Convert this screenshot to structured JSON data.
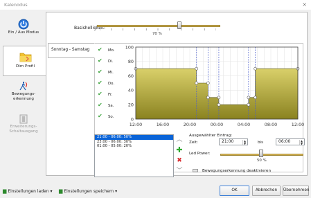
{
  "window": {
    "title": "Kalenodus",
    "close": "×"
  },
  "sidebar": {
    "items": [
      {
        "label": "Ein / Aus Modus"
      },
      {
        "label": "Dim Profil"
      },
      {
        "label": "Bewegungs-erkennung"
      },
      {
        "label": "Erweiterungs-Schaltausgang"
      }
    ]
  },
  "brightness": {
    "label": "Basishelligkeit:",
    "percent": "70 %",
    "value": 0.7
  },
  "day_tab": {
    "label": "Sonntag - Samstag"
  },
  "days": [
    "Mo.",
    "Di.",
    "Mi.",
    "Do.",
    "Fr.",
    "Sa.",
    "So."
  ],
  "chart_data": {
    "type": "area",
    "x_ticks": [
      "12:00",
      "16:00",
      "20:00",
      "00:00",
      "04:00",
      "08:00",
      "12:00"
    ],
    "y_ticks": [
      "100",
      "80",
      "60",
      "40",
      "20",
      "0"
    ],
    "ylim": [
      0,
      100
    ],
    "xlim_hours_from_noon": [
      0,
      24
    ],
    "profile": [
      {
        "x": 0,
        "y": 70
      },
      {
        "x": 9,
        "y": 70
      },
      {
        "x": 9,
        "y": 50
      },
      {
        "x": 10.7,
        "y": 50
      },
      {
        "x": 10.7,
        "y": 30
      },
      {
        "x": 12.3,
        "y": 30
      },
      {
        "x": 12.3,
        "y": 20
      },
      {
        "x": 16.7,
        "y": 20
      },
      {
        "x": 16.7,
        "y": 30
      },
      {
        "x": 17.7,
        "y": 30
      },
      {
        "x": 17.7,
        "y": 70
      },
      {
        "x": 24,
        "y": 70
      }
    ]
  },
  "entries": {
    "items": [
      "21:00 - 06:00: 50%",
      "23:00 - 06:00: 30%",
      "01:00 - 05:00: 20%"
    ],
    "selected": 0
  },
  "entry_editor": {
    "title": "Ausgewählter Eintrag:",
    "time_label": "Zeit:",
    "from": "21:00",
    "to_label": "bis",
    "to": "06:00",
    "power_label": "Led Power:",
    "power_percent": "50 %",
    "power_value": 0.5,
    "motion_toggle": "Bewegungserkennung deaktivieren"
  },
  "bottom": {
    "load": "Einstellungen laden",
    "save": "Einstellungen speichern",
    "ok": "OK",
    "cancel": "Abbrechen",
    "apply": "Übernehmen"
  }
}
